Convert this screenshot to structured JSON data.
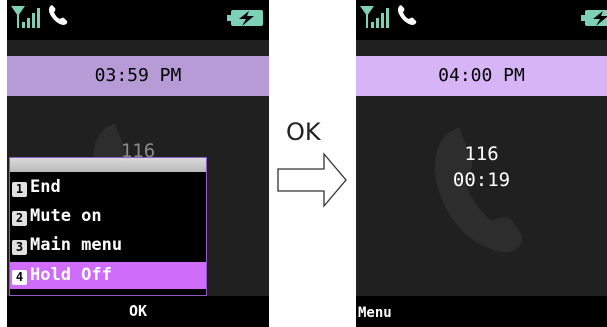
{
  "left_screen": {
    "time": "03:59 PM",
    "caller": "116",
    "menu": {
      "items": [
        {
          "num": "1",
          "label": "End"
        },
        {
          "num": "2",
          "label": "Mute on"
        },
        {
          "num": "3",
          "label": "Main menu"
        },
        {
          "num": "4",
          "label": "Hold Off"
        }
      ],
      "selected_index": 3
    },
    "softkey_center": "OK"
  },
  "transition": {
    "label": "OK",
    "arrow_icon": "arrow-right-icon"
  },
  "right_screen": {
    "time": "04:00 PM",
    "caller": "116",
    "duration": "00:19",
    "softkey_left": "Menu"
  },
  "icons": {
    "signal": "signal-strength-icon",
    "call": "phone-call-icon",
    "battery": "battery-charging-icon",
    "background": "phone-handset-icon"
  },
  "colors": {
    "time_bar_left": "#b79bd7",
    "time_bar_right": "#d6b4f5",
    "menu_selected": "#cf6cf9",
    "menu_border": "#8c5bc5"
  }
}
